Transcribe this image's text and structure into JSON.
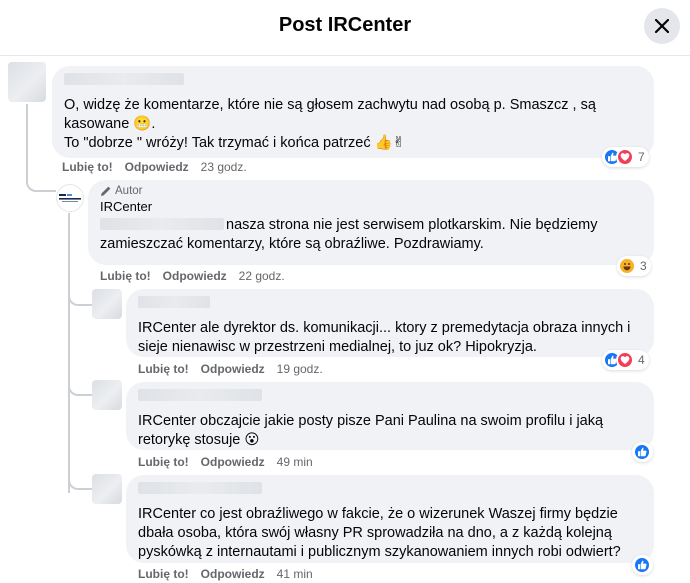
{
  "header": {
    "title": "Post IRCenter"
  },
  "comments": [
    {
      "text": "O, widzę że komentarze, które nie są głosem zachwytu nad osobą p. Smaszcz , są kasowane 😬.",
      "text2": "To \"dobrze \" wróży! Tak trzymać i końca patrzeć 👍✌",
      "like": "Lubię to!",
      "reply": "Odpowiedz",
      "time": "23 godz.",
      "reaction_count": "7"
    },
    {
      "badge": "Autor",
      "name": "IRCenter",
      "text": "nasza strona nie jest serwisem plotkarskim. Nie będziemy zamieszczać komentarzy, które są obraźliwe. Pozdrawiamy.",
      "like": "Lubię to!",
      "reply": "Odpowiedz",
      "time": "22 godz.",
      "reaction_count": "3"
    },
    {
      "mention": "IRCenter",
      "text": " ale dyrektor ds. komunikacji... ktory z premedytacja obraza innych i sieje nienawisc w przestrzeni medialnej, to juz ok? Hipokryzja.",
      "like": "Lubię to!",
      "reply": "Odpowiedz",
      "time": "19 godz.",
      "reaction_count": "4"
    },
    {
      "mention": "IRCenter",
      "text": " obczajcie jakie posty pisze Pani Paulina na swoim profilu i jaką retorykę stosuje 😮",
      "like": "Lubię to!",
      "reply": "Odpowiedz",
      "time": "49 min"
    },
    {
      "mention": "IRCenter",
      "text": " co jest obraźliwego w fakcie, że o wizerunek Waszej firmy będzie dbała osoba, która swój własny PR sprowadziła na dno, a z każdą kolejną pyskówką z internautami i publicznym szykanowaniem innych robi odwiert?",
      "like": "Lubię to!",
      "reply": "Odpowiedz",
      "time": "41 min"
    }
  ],
  "colors": {
    "accent": "#1877f2",
    "love": "#f33e58",
    "bubble": "#f0f2f5",
    "meta": "#65676b"
  },
  "icons": [
    "close-icon",
    "pencil-icon",
    "like-reaction-icon",
    "love-reaction-icon",
    "haha-reaction-icon"
  ]
}
